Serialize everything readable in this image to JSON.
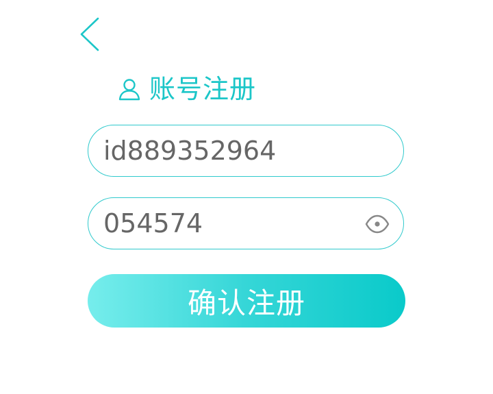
{
  "header": {
    "back_icon": "chevron-left-icon",
    "title_icon": "user-icon",
    "title": "账号注册"
  },
  "form": {
    "account": {
      "value": "id889352964",
      "placeholder": ""
    },
    "password": {
      "value": "054574",
      "placeholder": "",
      "toggle_icon": "eye-icon"
    },
    "submit_label": "确认注册"
  },
  "colors": {
    "accent": "#1cc6c8",
    "field_border": "#2ec9cc",
    "input_text": "#666666",
    "button_gradient_start": "#76edec",
    "button_gradient_end": "#0acaca",
    "button_text": "#ffffff"
  }
}
